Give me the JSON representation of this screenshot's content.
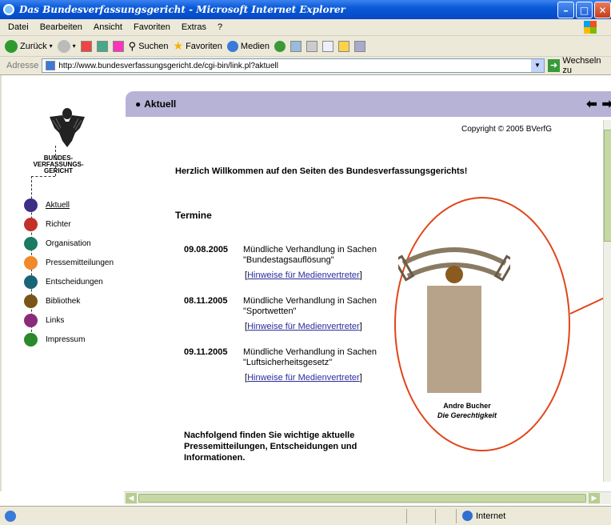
{
  "window": {
    "title": "Das Bundesverfassungsgericht - Microsoft Internet Explorer"
  },
  "menu": [
    "Datei",
    "Bearbeiten",
    "Ansicht",
    "Favoriten",
    "Extras",
    "?"
  ],
  "toolbar": {
    "back": "Zurück",
    "search": "Suchen",
    "favorites": "Favoriten",
    "media": "Medien"
  },
  "address": {
    "label": "Adresse",
    "url": "http://www.bundesverfassungsgericht.de/cgi-bin/link.pl?aktuell",
    "go": "Wechseln zu"
  },
  "page": {
    "section_title": "Aktuell",
    "court_name": [
      "BUNDES-",
      "VERFASSUNGS-",
      "GERICHT"
    ],
    "copyright": "Copyright © 2005 BVerfG",
    "welcome": "Herzlich Willkommen auf den Seiten des Bundesverfassungsgerichts!",
    "termine_heading": "Termine",
    "nav": [
      {
        "label": "Aktuell",
        "color": "#3c2f86"
      },
      {
        "label": "Richter",
        "color": "#c3312b"
      },
      {
        "label": "Organisation",
        "color": "#1a7a62"
      },
      {
        "label": "Pressemitteilungen",
        "color": "#f0892a"
      },
      {
        "label": "Entscheidungen",
        "color": "#1a6478"
      },
      {
        "label": "Bibliothek",
        "color": "#7a5518"
      },
      {
        "label": "Links",
        "color": "#8a2a7a"
      },
      {
        "label": "Impressum",
        "color": "#2a8a2a"
      }
    ],
    "events": [
      {
        "date": "09.08.2005",
        "desc": "Mündliche Verhandlung in Sachen \"Bundestagsauflösung\"",
        "hint_pre": "[",
        "hint": "Hinweise für Medienvertreter",
        "hint_post": "]"
      },
      {
        "date": "08.11.2005",
        "desc": "Mündliche Verhandlung in Sachen \"Sportwetten\"",
        "hint_pre": "[",
        "hint": "Hinweise für Medienvertreter",
        "hint_post": "]"
      },
      {
        "date": "09.11.2005",
        "desc": "Mündliche Verhandlung in Sachen \"Luftsicherheitsgesetz\"",
        "hint_pre": "[",
        "hint": "Hinweise für Medienvertreter",
        "hint_post": "]"
      }
    ],
    "following": "Nachfolgend finden Sie wichtige aktuelle Pressemitteilungen, Entscheidungen und Informationen.",
    "caption_artist": "Andre Bucher",
    "caption_title": "Die Gerechtigkeit"
  },
  "status": {
    "zone": "Internet"
  },
  "colors": {
    "accent_band": "#b7b3d7",
    "highlight_oval": "#e0461a"
  }
}
